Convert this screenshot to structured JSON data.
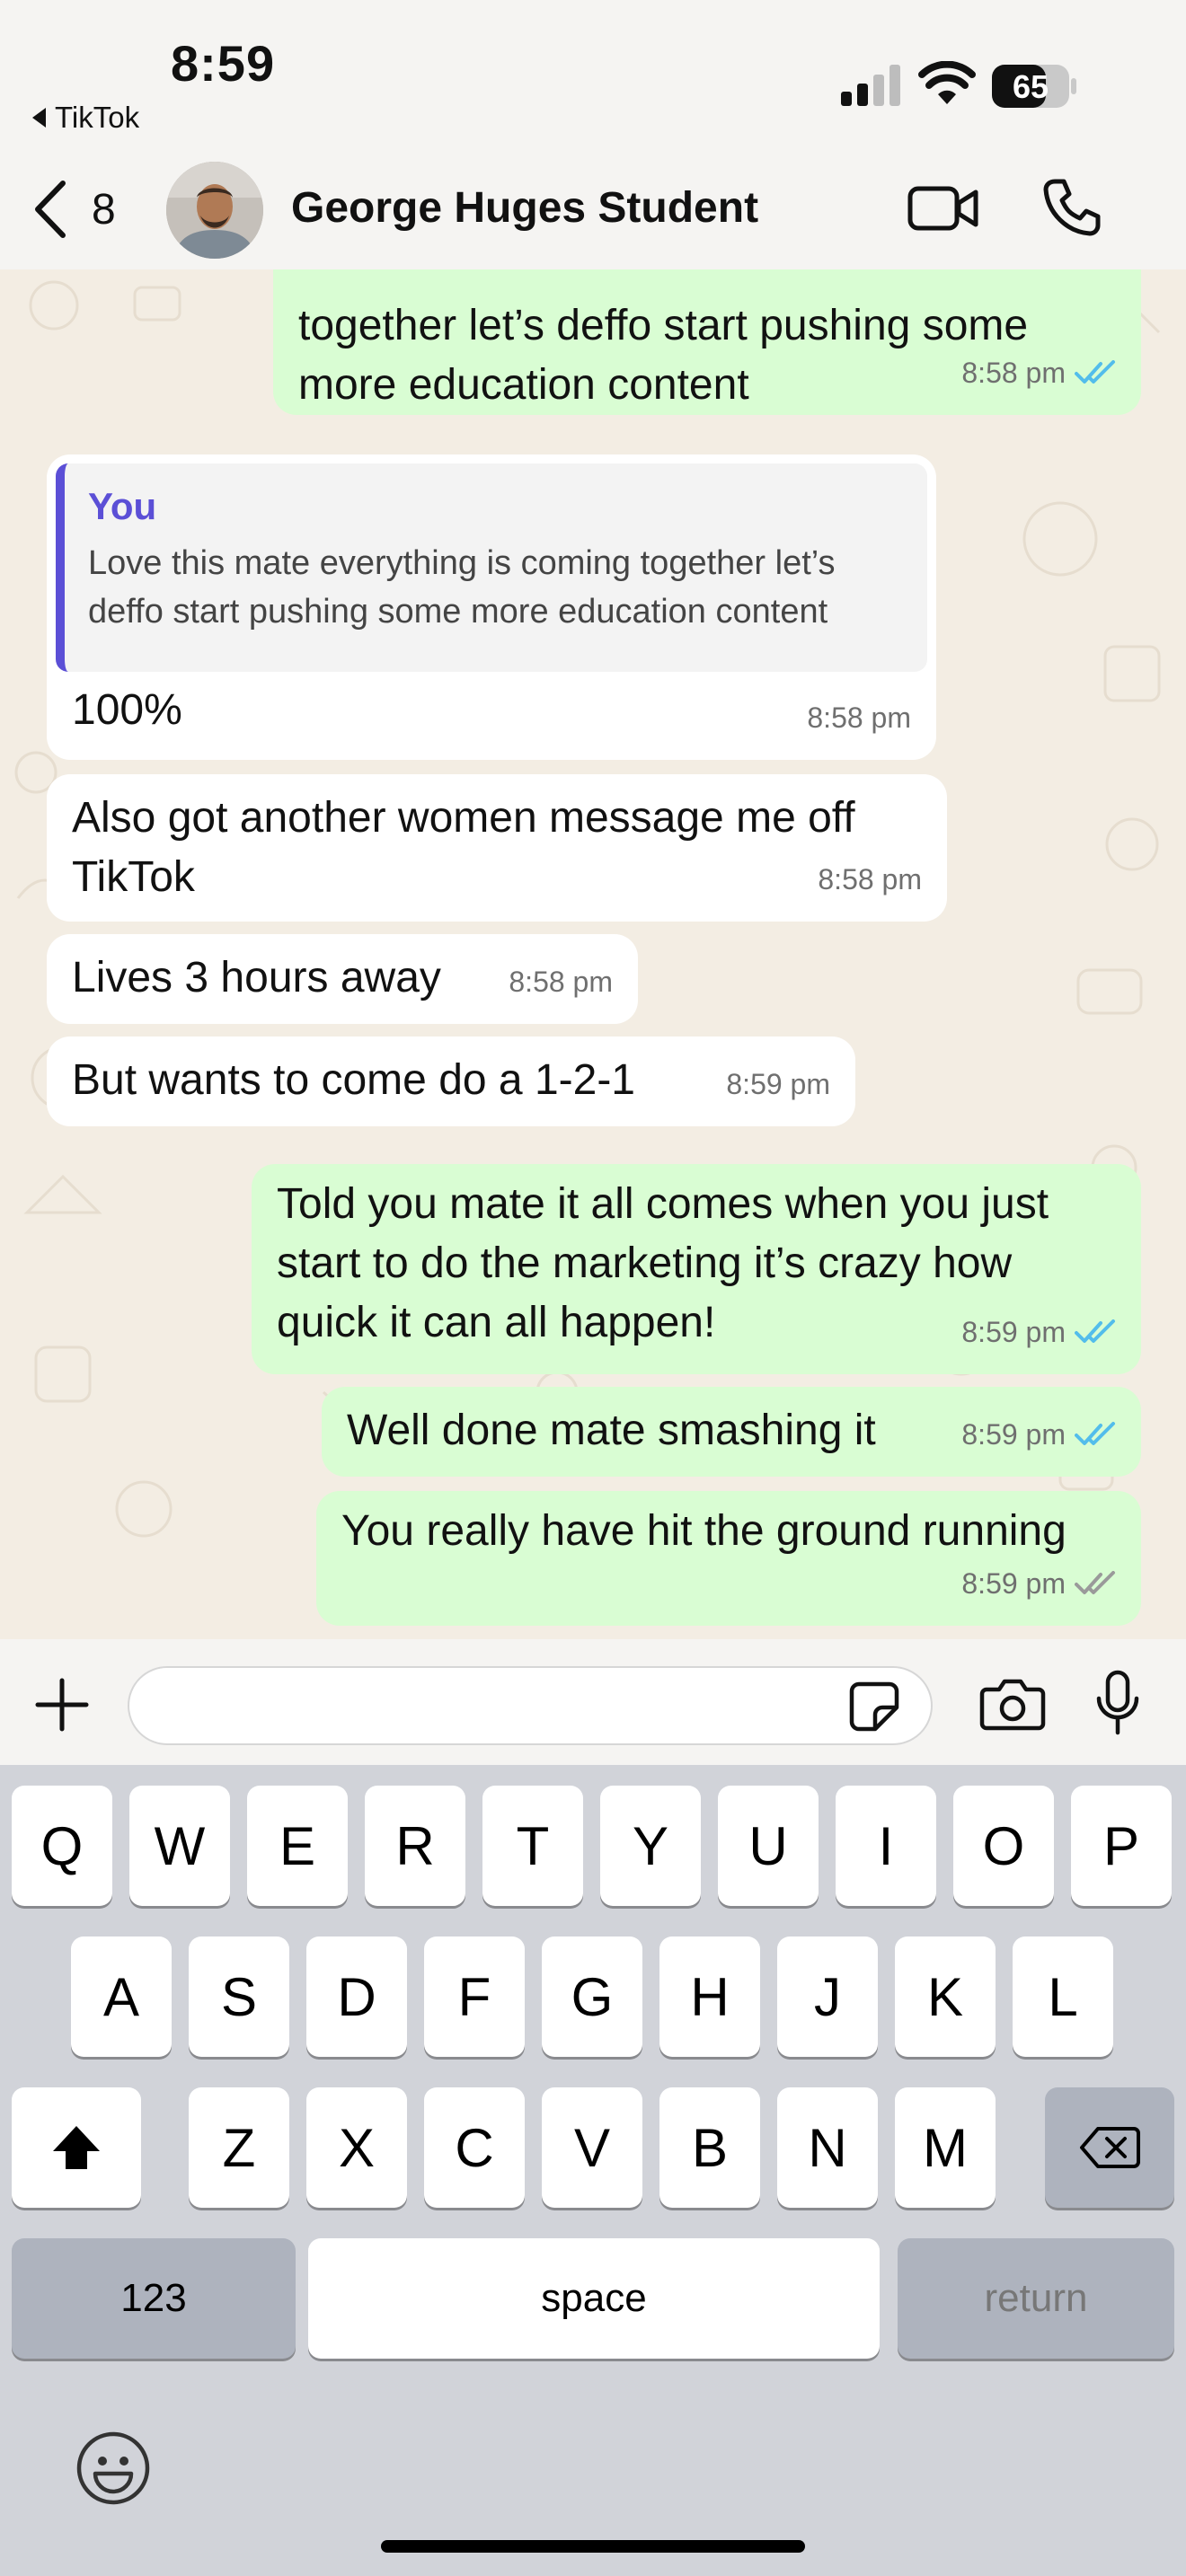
{
  "status_bar": {
    "time": "8:59",
    "back_app": "TikTok",
    "battery": "65"
  },
  "header": {
    "back_count": "8",
    "contact_name": "George Huges Student"
  },
  "messages": [
    {
      "direction": "outgoing",
      "lines": [
        "together let’s deffo start pushing some",
        "more education content"
      ],
      "time": "8:58 pm",
      "status": "read"
    },
    {
      "direction": "incoming",
      "quote": {
        "author": "You",
        "lines": [
          "Love this mate everything is coming together let’s",
          "deffo start pushing some more education content"
        ]
      },
      "lines": [
        "100%"
      ],
      "time": "8:58 pm"
    },
    {
      "direction": "incoming",
      "lines": [
        "Also got another women message me off",
        "TikTok"
      ],
      "time": "8:58 pm"
    },
    {
      "direction": "incoming",
      "lines": [
        "Lives 3 hours away"
      ],
      "time": "8:58 pm"
    },
    {
      "direction": "incoming",
      "lines": [
        "But wants to come do a 1-2-1"
      ],
      "time": "8:59 pm"
    },
    {
      "direction": "outgoing",
      "lines": [
        "Told you mate it all comes when you just",
        "start to do the marketing it’s crazy how",
        "quick it can all happen!"
      ],
      "time": "8:59 pm",
      "status": "read"
    },
    {
      "direction": "outgoing",
      "lines": [
        "Well done mate smashing it"
      ],
      "time": "8:59 pm",
      "status": "read"
    },
    {
      "direction": "outgoing",
      "lines": [
        "You really have hit the ground running"
      ],
      "time": "8:59 pm",
      "status": "delivered"
    }
  ],
  "input": {
    "placeholder": ""
  },
  "keyboard": {
    "row1": [
      "Q",
      "W",
      "E",
      "R",
      "T",
      "Y",
      "U",
      "I",
      "O",
      "P"
    ],
    "row2": [
      "A",
      "S",
      "D",
      "F",
      "G",
      "H",
      "J",
      "K",
      "L"
    ],
    "row3": [
      "Z",
      "X",
      "C",
      "V",
      "B",
      "N",
      "M"
    ],
    "numbers_label": "123",
    "space_label": "space",
    "return_label": "return"
  },
  "icons": {
    "status_bar": [
      "signal-icon",
      "wifi-icon",
      "battery-icon"
    ],
    "header": [
      "back-chevron-icon",
      "avatar",
      "video-call-icon",
      "phone-call-icon"
    ],
    "input_bar": [
      "plus-icon",
      "sticker-icon",
      "camera-icon",
      "microphone-icon"
    ],
    "keyboard": [
      "shift-icon",
      "backspace-icon",
      "emoji-icon"
    ]
  },
  "colors": {
    "outgoing_bubble": "#d9fdd3",
    "incoming_bubble": "#ffffff",
    "read_ticks": "#53bdeb",
    "quote_accent": "#5b4fd6",
    "chat_background": "#f3ede3"
  }
}
